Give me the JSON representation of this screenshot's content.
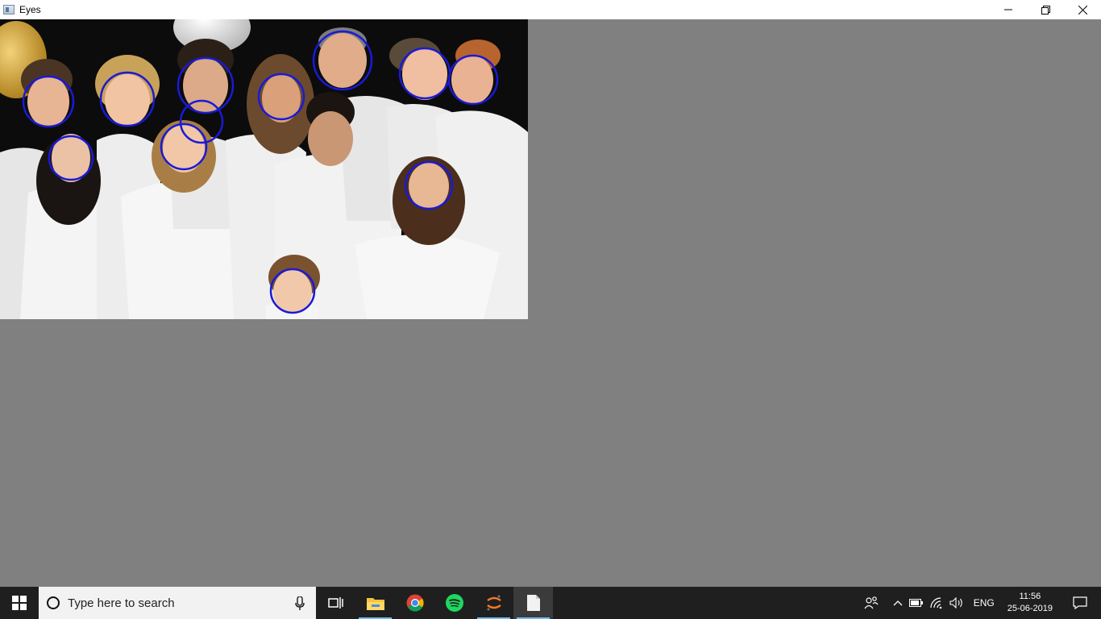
{
  "window": {
    "title": "Eyes",
    "icon": "app-window-icon",
    "controls": [
      "minimize-icon",
      "restore-icon",
      "close-icon"
    ]
  },
  "image": {
    "description_type": "photo-with-face-detection-circles",
    "circle_color": "#1a1ad6",
    "background_color": "#808080"
  },
  "taskbar": {
    "search_placeholder": "Type here to search",
    "apps": [
      "task-view-icon",
      "file-explorer-icon",
      "chrome-icon",
      "spotify-icon",
      "jupyter-icon",
      "file-icon"
    ],
    "tray": {
      "language": "ENG",
      "time": "11:56",
      "date": "25-06-2019"
    }
  }
}
